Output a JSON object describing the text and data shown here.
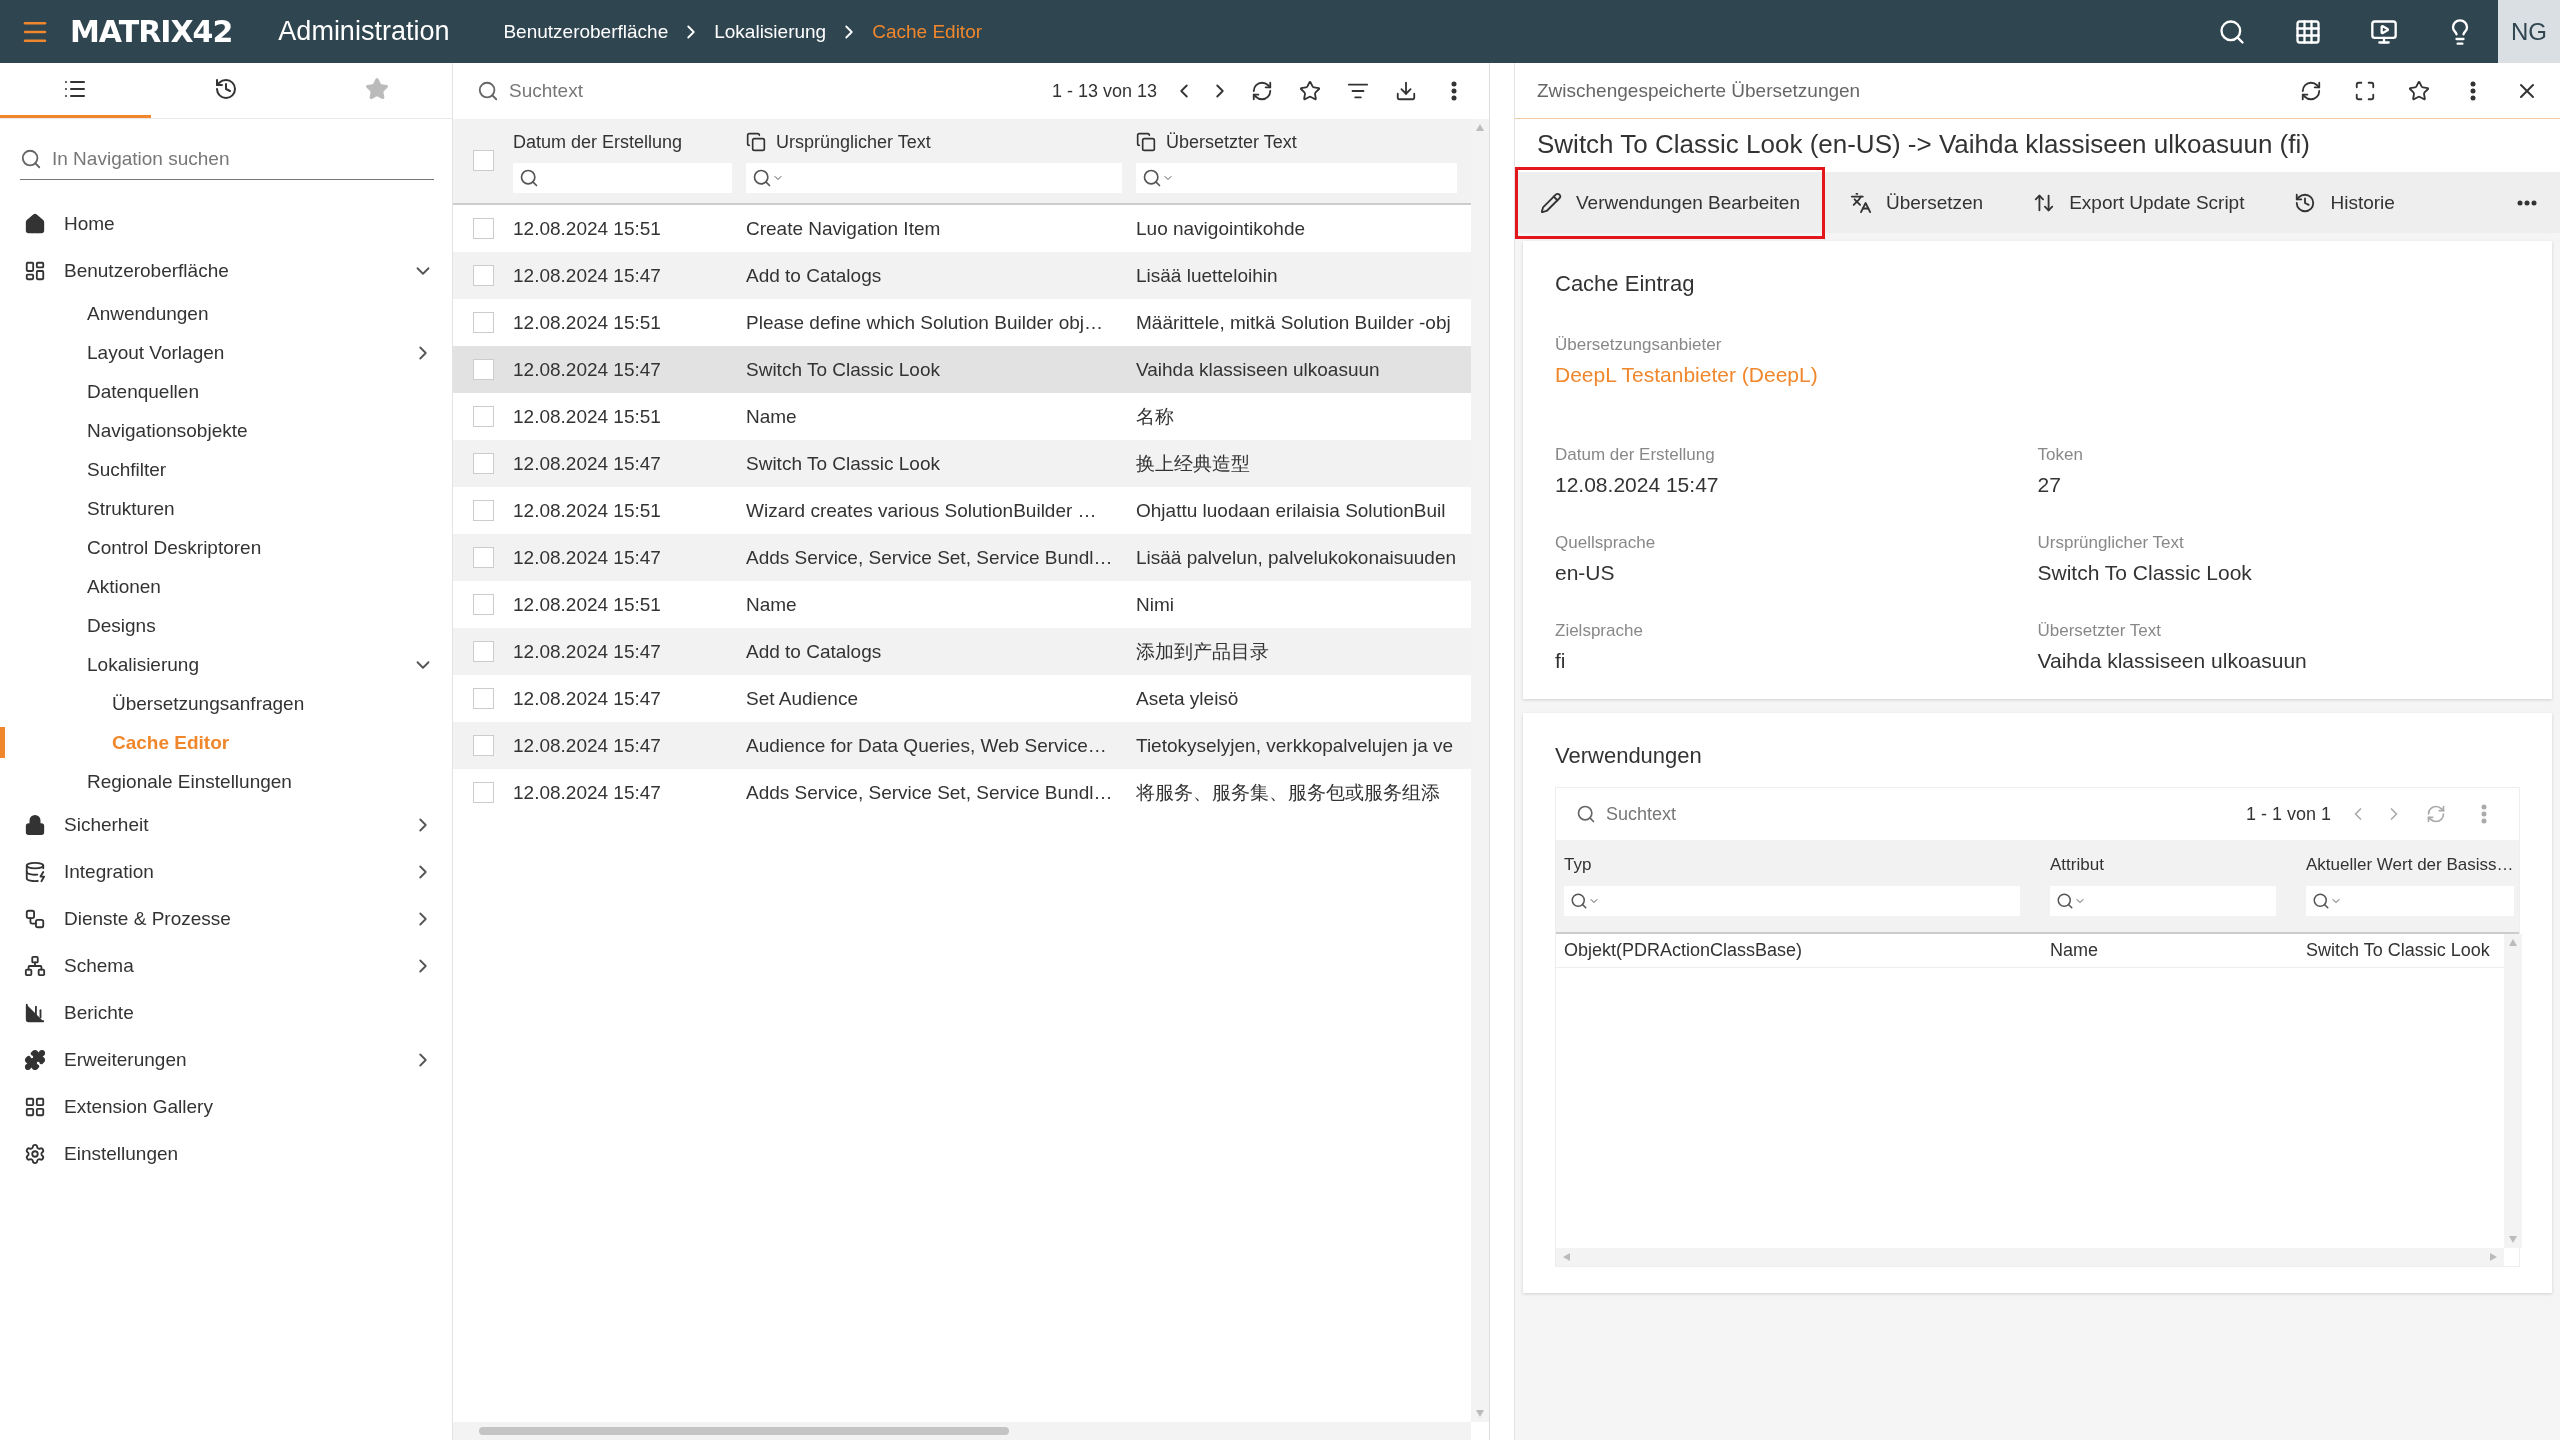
{
  "app": {
    "logo": "MATRIX42",
    "title": "Administration",
    "avatar": "NG"
  },
  "breadcrumbs": [
    {
      "label": "Benutzeroberfläche",
      "current": false
    },
    {
      "label": "Lokalisierung",
      "current": false
    },
    {
      "label": "Cache Editor",
      "current": true
    }
  ],
  "sidebar": {
    "tabs": [
      {
        "selected": true
      },
      {
        "selected": false
      },
      {
        "selected": false
      }
    ],
    "search": {
      "placeholder": "In Navigation suchen"
    },
    "items": [
      {
        "label": "Home",
        "selected": false
      },
      {
        "label": "Benutzeroberfläche",
        "selected": false,
        "expanded": true,
        "children": [
          {
            "label": "Anwendungen",
            "selected": false
          },
          {
            "label": "Layout Vorlagen",
            "selected": false,
            "expanded": false
          },
          {
            "label": "Datenquellen",
            "selected": false
          },
          {
            "label": "Navigationsobjekte",
            "selected": false
          },
          {
            "label": "Suchfilter",
            "selected": false
          },
          {
            "label": "Strukturen",
            "selected": false
          },
          {
            "label": "Control Deskriptoren",
            "selected": false
          },
          {
            "label": "Aktionen",
            "selected": false
          },
          {
            "label": "Designs",
            "selected": false
          },
          {
            "label": "Lokalisierung",
            "selected": false,
            "expanded": true,
            "children": [
              {
                "label": "Übersetzungsanfragen",
                "selected": false
              },
              {
                "label": "Cache Editor",
                "selected": true
              }
            ]
          },
          {
            "label": "Regionale Einstellungen",
            "selected": false
          }
        ]
      },
      {
        "label": "Sicherheit",
        "selected": false,
        "expanded": false
      },
      {
        "label": "Integration",
        "selected": false,
        "expanded": false
      },
      {
        "label": "Dienste & Prozesse",
        "selected": false,
        "expanded": false
      },
      {
        "label": "Schema",
        "selected": false,
        "expanded": false
      },
      {
        "label": "Berichte",
        "selected": false
      },
      {
        "label": "Erweiterungen",
        "selected": false,
        "expanded": false
      },
      {
        "label": "Extension Gallery",
        "selected": false
      },
      {
        "label": "Einstellungen",
        "selected": false
      }
    ]
  },
  "list": {
    "search": {
      "placeholder": "Suchtext"
    },
    "pager": "1 - 13 von 13",
    "header_checked": false,
    "columns": [
      {
        "label": "Datum der Erstellung",
        "kind": "plain"
      },
      {
        "label": "Ursprünglicher Text",
        "kind": "copy"
      },
      {
        "label": "Übersetzter Text",
        "kind": "copy"
      }
    ],
    "rows": [
      {
        "date": "12.08.2024 15:51",
        "original": "Create Navigation Item",
        "translated": "Luo navigointikohde",
        "checked": false,
        "selected": false
      },
      {
        "date": "12.08.2024 15:47",
        "original": "Add to Catalogs",
        "translated": "Lisää luetteloihin",
        "checked": false,
        "selected": false
      },
      {
        "date": "12.08.2024 15:51",
        "original": "Please define which Solution Builder obj…",
        "translated": "Määrittele, mitkä Solution Builder -obj",
        "checked": false,
        "selected": false
      },
      {
        "date": "12.08.2024 15:47",
        "original": "Switch To Classic Look",
        "translated": "Vaihda klassiseen ulkoasuun",
        "checked": false,
        "selected": true
      },
      {
        "date": "12.08.2024 15:51",
        "original": "Name",
        "translated": "名称",
        "checked": false,
        "selected": false
      },
      {
        "date": "12.08.2024 15:47",
        "original": "Switch To Classic Look",
        "translated": "换上经典造型",
        "checked": false,
        "selected": false
      },
      {
        "date": "12.08.2024 15:51",
        "original": "Wizard creates various SolutionBuilder …",
        "translated": "Ohjattu luodaan erilaisia SolutionBuil",
        "checked": false,
        "selected": false
      },
      {
        "date": "12.08.2024 15:47",
        "original": "Adds Service, Service Set, Service Bundl…",
        "translated": "Lisää palvelun, palvelukokonaisuuden",
        "checked": false,
        "selected": false
      },
      {
        "date": "12.08.2024 15:51",
        "original": "Name",
        "translated": "Nimi",
        "checked": false,
        "selected": false
      },
      {
        "date": "12.08.2024 15:47",
        "original": "Add to Catalogs",
        "translated": "添加到产品目录",
        "checked": false,
        "selected": false
      },
      {
        "date": "12.08.2024 15:47",
        "original": "Set Audience",
        "translated": "Aseta yleisö",
        "checked": false,
        "selected": false
      },
      {
        "date": "12.08.2024 15:47",
        "original": "Audience for Data Queries, Web Service…",
        "translated": "Tietokyselyjen, verkkopalvelujen ja ve",
        "checked": false,
        "selected": false
      },
      {
        "date": "12.08.2024 15:47",
        "original": "Adds Service, Service Set, Service Bundl…",
        "translated": "将服务、服务集、服务包或服务组添",
        "checked": false,
        "selected": false
      }
    ]
  },
  "detail": {
    "panel_title": "Zwischengespeicherte Übersetzungen",
    "record_title": "Switch To Classic Look (en-US) -> Vaihda klassiseen ulkoasuun (fi)",
    "actions": [
      {
        "label": "Verwendungen Bearbeiten",
        "highlighted": true
      },
      {
        "label": "Übersetzen",
        "highlighted": false
      },
      {
        "label": "Export Update Script",
        "highlighted": false
      },
      {
        "label": "Historie",
        "highlighted": false
      }
    ],
    "card": {
      "title": "Cache Eintrag",
      "provider": {
        "label": "Übersetzungsanbieter",
        "value": "DeepL Testanbieter (DeepL)"
      },
      "fields": [
        {
          "label": "Datum der Erstellung",
          "value": "12.08.2024 15:47"
        },
        {
          "label": "Token",
          "value": "27"
        },
        {
          "label": "Quellsprache",
          "value": "en-US"
        },
        {
          "label": "Ursprünglicher Text",
          "value": "Switch To Classic Look"
        },
        {
          "label": "Zielsprache",
          "value": "fi"
        },
        {
          "label": "Übersetzter Text",
          "value": "Vaihda klassiseen ulkoasuun"
        }
      ]
    },
    "usages": {
      "title": "Verwendungen",
      "search": {
        "placeholder": "Suchtext"
      },
      "pager": "1 - 1 von 1",
      "columns": [
        "Typ",
        "Attribut",
        "Aktueller Wert der Basiss…"
      ],
      "rows": [
        [
          "Objekt(PDRActionClassBase)",
          "Name",
          "Switch To Classic Look"
        ]
      ]
    }
  }
}
